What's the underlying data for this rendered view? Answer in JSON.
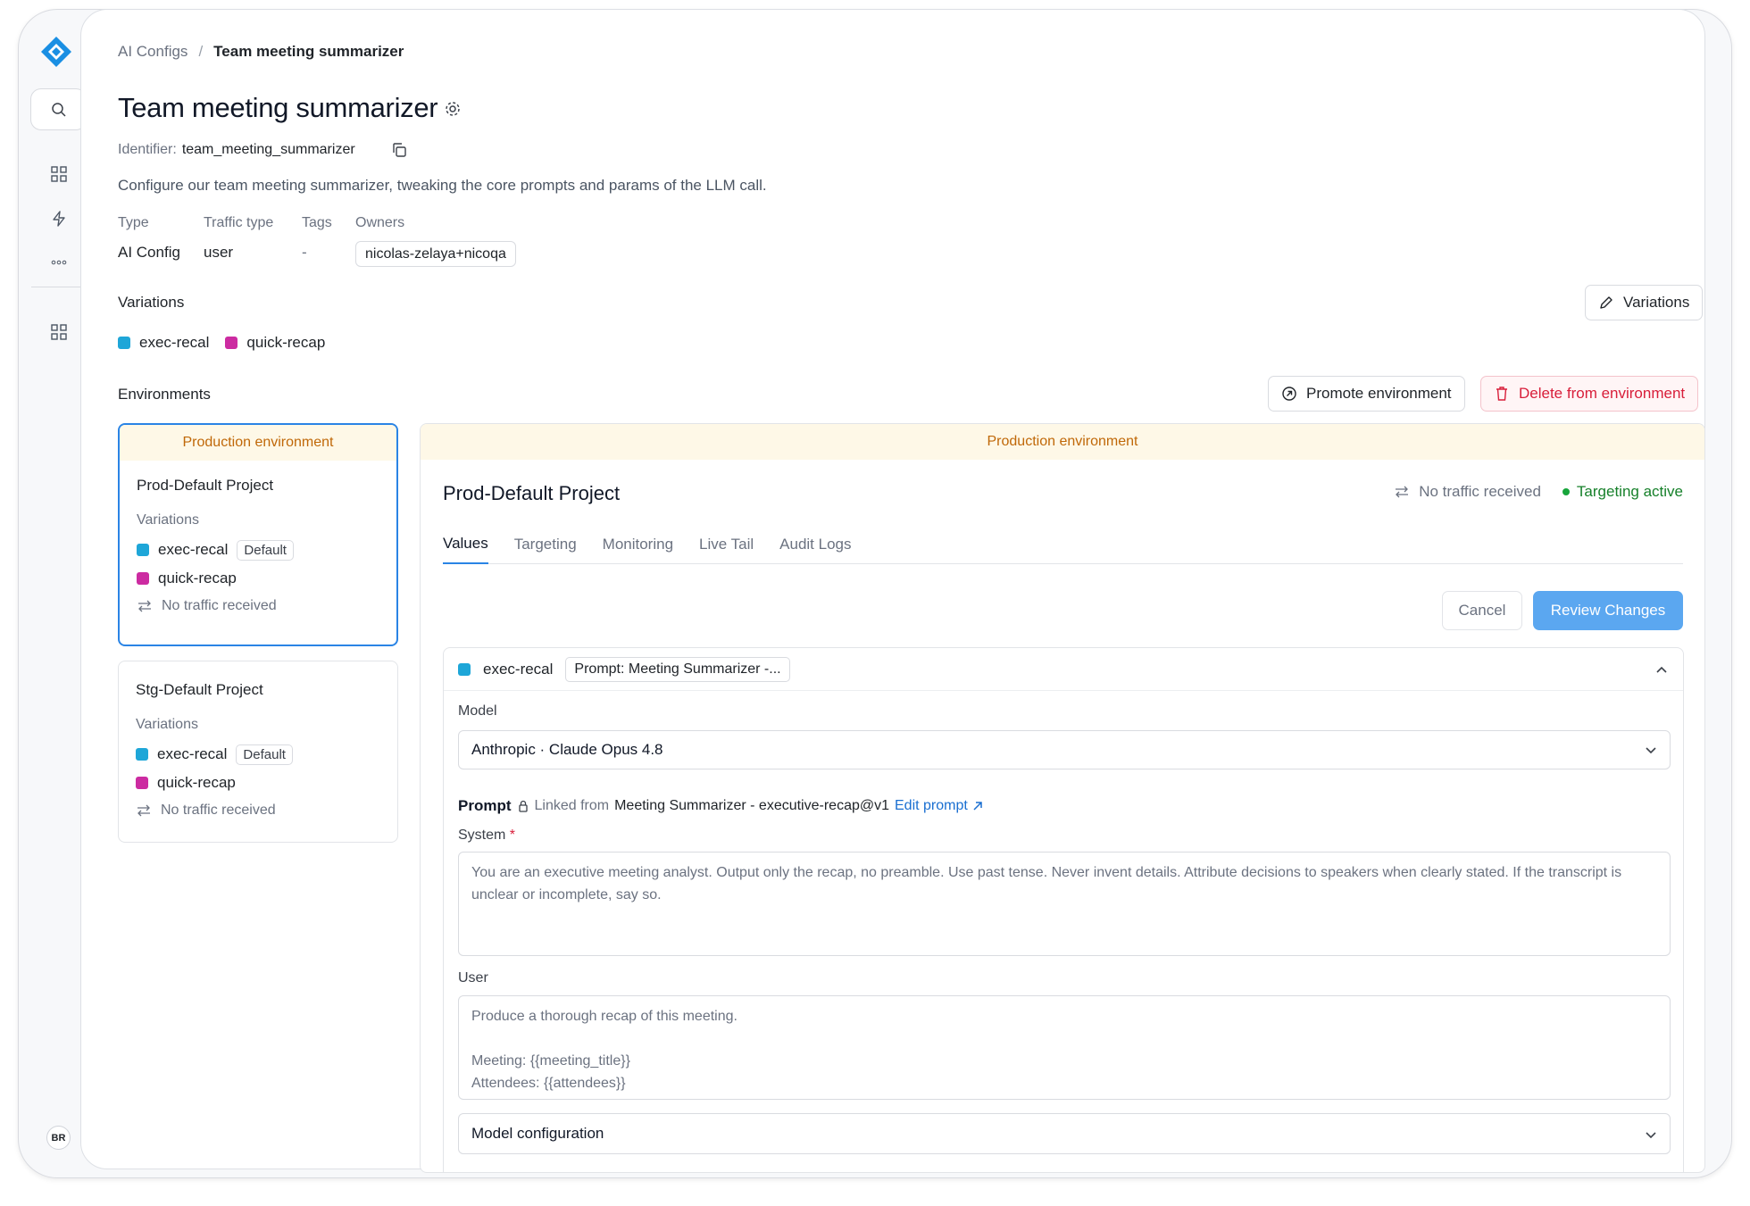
{
  "breadcrumb": {
    "parent": "AI Configs",
    "separator": "/",
    "current": "Team meeting summarizer"
  },
  "page": {
    "title": "Team meeting summarizer",
    "identifier_label": "Identifier:",
    "identifier_value": "team_meeting_summarizer",
    "description": "Configure our team meeting summarizer, tweaking the core prompts and params of the LLM call."
  },
  "meta": {
    "type_label": "Type",
    "type_value": "AI Config",
    "traffic_label": "Traffic type",
    "traffic_value": "user",
    "tags_label": "Tags",
    "tags_value": "-",
    "owners_label": "Owners",
    "owners_value": "nicolas-zelaya+nicoqa"
  },
  "variations": {
    "heading": "Variations",
    "button": "Variations",
    "items": [
      {
        "name": "exec-recal",
        "color": "#1ea6d8"
      },
      {
        "name": "quick-recap",
        "color": "#cc2ba1"
      }
    ]
  },
  "environments": {
    "heading": "Environments",
    "promote": "Promote environment",
    "delete": "Delete from environment",
    "cards": [
      {
        "banner": "Production environment",
        "name": "Prod-Default Project",
        "variations_label": "Variations",
        "var1": "exec-recal",
        "default_tag": "Default",
        "var2": "quick-recap",
        "traffic": "No traffic received"
      },
      {
        "name": "Stg-Default Project",
        "variations_label": "Variations",
        "var1": "exec-recal",
        "default_tag": "Default",
        "var2": "quick-recap",
        "traffic": "No traffic received"
      }
    ]
  },
  "detail": {
    "banner": "Production environment",
    "title": "Prod-Default Project",
    "traffic": "No traffic received",
    "targeting": "Targeting active",
    "tabs": [
      "Values",
      "Targeting",
      "Monitoring",
      "Live Tail",
      "Audit Logs"
    ],
    "cancel": "Cancel",
    "review": "Review Changes",
    "variation": {
      "name": "exec-recal",
      "prompt_chip": "Prompt: Meeting Summarizer -...",
      "model_label": "Model",
      "model_value": "Anthropic · Claude Opus 4.8",
      "prompt_label": "Prompt",
      "linked_from": "Linked from",
      "linked_source": "Meeting Summarizer - executive-recap@v1",
      "edit_prompt": "Edit prompt",
      "system_label": "System",
      "required_mark": "*",
      "system_text": "You are an executive meeting analyst. Output only the recap, no preamble. Use past tense. Never invent details. Attribute decisions to speakers when clearly stated. If the transcript is unclear or incomplete, say so.",
      "user_label": "User",
      "user_text": "Produce a thorough recap of this meeting.\n\nMeeting: {{meeting_title}}\nAttendees: {{attendees}}",
      "model_config": "Model configuration"
    }
  },
  "user": {
    "initials": "BR"
  },
  "colors": {
    "accent": "#2a84e5",
    "banner_text": "#c06808",
    "banner_bg": "#fef8e7",
    "danger": "#d81e3a",
    "success": "#16802a"
  }
}
